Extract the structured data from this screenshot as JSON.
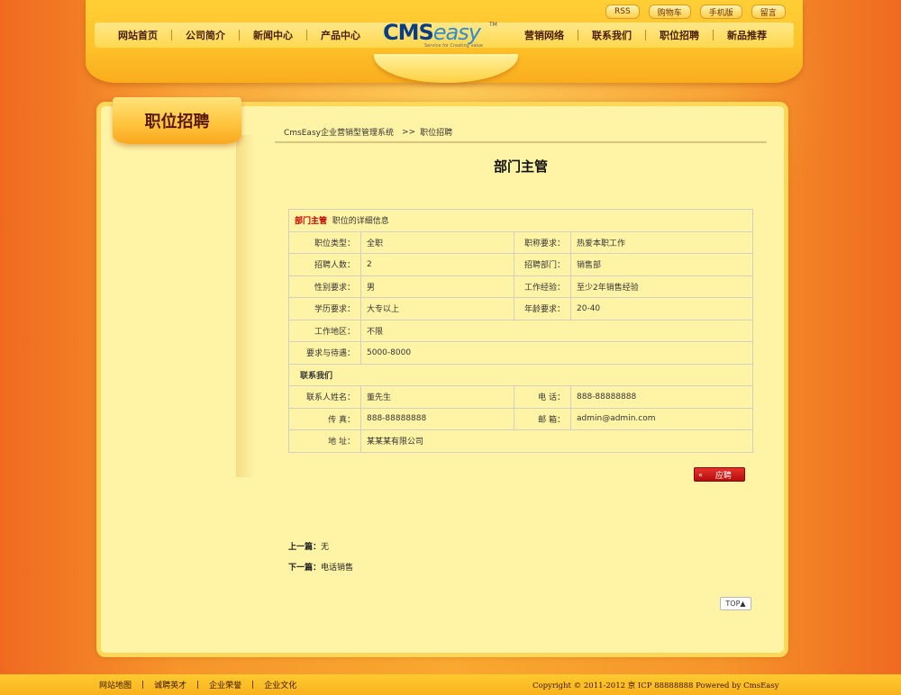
{
  "header": {
    "top_buttons": [
      "RSS",
      "购物车",
      "手机版",
      "留言"
    ],
    "nav_left": [
      "网站首页",
      "公司简介",
      "新闻中心",
      "产品中心"
    ],
    "nav_right": [
      "营销网络",
      "联系我们",
      "职位招聘",
      "新品推荐"
    ],
    "logo": {
      "part1": "CMS",
      "part2": "easy",
      "tm": "TM",
      "slogan": "Service for Creating value"
    }
  },
  "sidebar": {
    "title": "职位招聘"
  },
  "breadcrumb": {
    "home": "CmsEasy企业营销型管理系统",
    "sep": ">>",
    "current": "职位招聘"
  },
  "job": {
    "title": "部门主管",
    "header_name": "部门主管",
    "header_suffix": "职位的详细信息",
    "rows": [
      {
        "l1": "职位类型：",
        "v1": "全职",
        "l2": "职称要求：",
        "v2": "热爱本职工作"
      },
      {
        "l1": "招聘人数：",
        "v1": "2",
        "l2": "招聘部门：",
        "v2": "销售部"
      },
      {
        "l1": "性别要求：",
        "v1": "男",
        "l2": "工作经验：",
        "v2": "至少2年销售经验"
      },
      {
        "l1": "学历要求：",
        "v1": "大专以上",
        "l2": "年龄要求：",
        "v2": "20-40"
      }
    ],
    "area_label": "工作地区：",
    "area_value": "不限",
    "salary_label": "要求与待遇：",
    "salary_value": "5000-8000",
    "contact_heading": "联系我们",
    "contact_name_label": "联系人姓名：",
    "contact_name": "董先生",
    "phone_label": "电  话：",
    "phone": "888-88888888",
    "fax_label": "传  真：",
    "fax": "888-88888888",
    "email_label": "邮  箱：",
    "email": "admin@admin.com",
    "address_label": "地  址：",
    "address": "某某某有限公司"
  },
  "apply_button": {
    "arrow": "«",
    "label": "应聘"
  },
  "prev": {
    "label": "上一篇：",
    "value": "无"
  },
  "next": {
    "label": "下一篇：",
    "value": "电话销售"
  },
  "top_button": "TOP▲",
  "footer": {
    "links": [
      "网站地图",
      "诚聘英才",
      "企业荣誉",
      "企业文化"
    ],
    "separator": "|",
    "copyright": "Copyright © 2011-2012   京 ICP 88888888  Powered by CmsEasy"
  }
}
